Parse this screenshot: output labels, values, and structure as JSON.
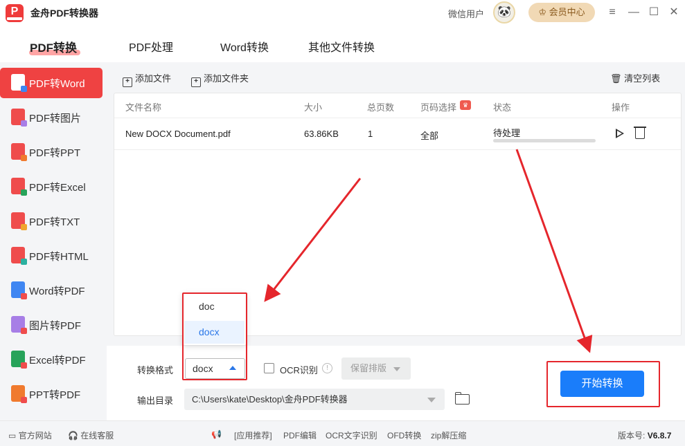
{
  "app": {
    "title": "金舟PDF转换器",
    "logo_letter": "P"
  },
  "header": {
    "user": "微信用户",
    "vip": "会员中心",
    "vip_icon": "crown-icon"
  },
  "nav": {
    "tabs": [
      "PDF转换",
      "PDF处理",
      "Word转换",
      "其他文件转换"
    ],
    "active": "PDF转换"
  },
  "sidebar": {
    "items": [
      {
        "label": "PDF转Word",
        "icon": "pdf-to-word-icon"
      },
      {
        "label": "PDF转图片",
        "icon": "pdf-to-image-icon"
      },
      {
        "label": "PDF转PPT",
        "icon": "pdf-to-ppt-icon"
      },
      {
        "label": "PDF转Excel",
        "icon": "pdf-to-excel-icon"
      },
      {
        "label": "PDF转TXT",
        "icon": "pdf-to-txt-icon"
      },
      {
        "label": "PDF转HTML",
        "icon": "pdf-to-html-icon"
      },
      {
        "label": "Word转PDF",
        "icon": "word-to-pdf-icon"
      },
      {
        "label": "图片转PDF",
        "icon": "image-to-pdf-icon"
      },
      {
        "label": "Excel转PDF",
        "icon": "excel-to-pdf-icon"
      },
      {
        "label": "PPT转PDF",
        "icon": "ppt-to-pdf-icon"
      }
    ],
    "active_index": 0
  },
  "toolbar": {
    "add_file": "添加文件",
    "add_folder": "添加文件夹",
    "clear_list": "清空列表"
  },
  "table": {
    "headers": [
      "文件名称",
      "大小",
      "总页数",
      "页码选择",
      "状态",
      "操作"
    ],
    "rows": [
      {
        "name": "New DOCX Document.pdf",
        "size": "63.86KB",
        "pages": "1",
        "range": "全部",
        "status": "待处理",
        "progress": 0
      }
    ]
  },
  "settings": {
    "format_label": "转换格式",
    "format_value": "docx",
    "format_options": [
      "doc",
      "docx"
    ],
    "ocr_label": "OCR识别",
    "ocr_checked": false,
    "layout_value": "保留排版",
    "output_label": "输出目录",
    "output_path": "C:\\Users\\kate\\Desktop\\金舟PDF转换器",
    "start_button": "开始转换"
  },
  "status_bar": {
    "website": "官方网站",
    "support": "在线客服",
    "links": [
      "[应用推荐]",
      "PDF编辑",
      "OCR文字识别",
      "OFD转换",
      "zip解压缩"
    ],
    "version_label": "版本号:",
    "version": "V6.8.7"
  },
  "colors": {
    "accent_red": "#ef4242",
    "primary_blue": "#1a7dfa",
    "annotation_red": "#e5262c"
  }
}
